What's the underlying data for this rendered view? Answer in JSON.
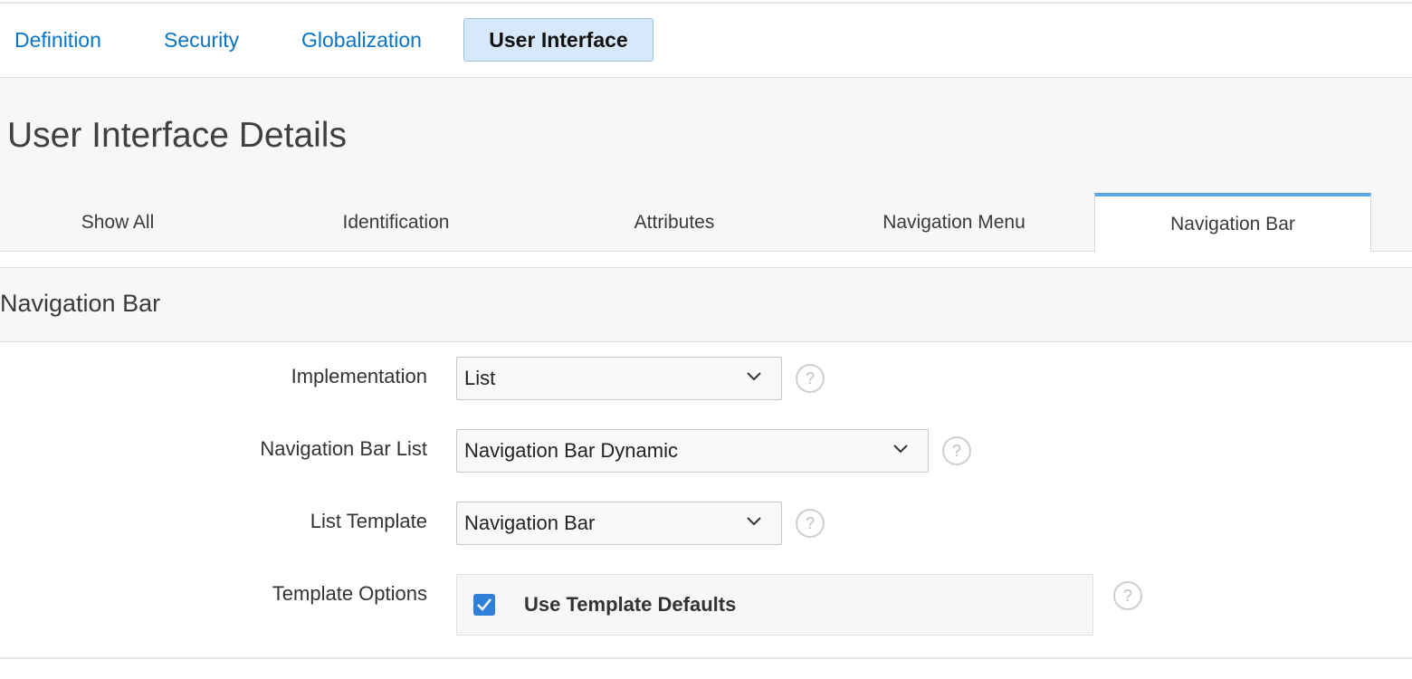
{
  "top_tabs": {
    "items": [
      "Definition",
      "Security",
      "Globalization",
      "User Interface"
    ],
    "active": "User Interface"
  },
  "page": {
    "title": "User Interface Details"
  },
  "sub_tabs": {
    "items": [
      "Show All",
      "Identification",
      "Attributes",
      "Navigation Menu",
      "Navigation Bar"
    ],
    "active": "Navigation Bar"
  },
  "section": {
    "title": "Navigation Bar"
  },
  "form": {
    "implementation": {
      "label": "Implementation",
      "value": "List"
    },
    "nav_bar_list": {
      "label": "Navigation Bar List",
      "value": "Navigation Bar Dynamic"
    },
    "list_template": {
      "label": "List Template",
      "value": "Navigation Bar"
    },
    "template_options": {
      "label": "Template Options",
      "checkbox_label": "Use Template Defaults",
      "checked": true
    }
  },
  "icons": {
    "help": "?"
  },
  "colors": {
    "accent": "#0a74c7",
    "active_tab_bg": "#d6e8fa",
    "subtab_indicator": "#5aa7e8",
    "checkbox": "#2f7fd6"
  }
}
